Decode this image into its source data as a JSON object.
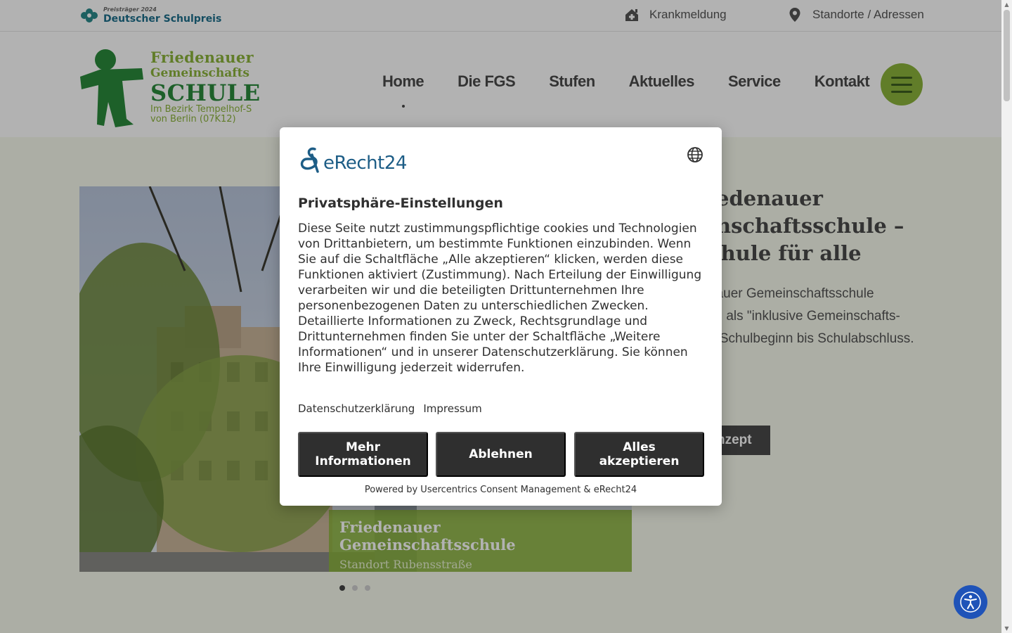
{
  "topbar": {
    "prize_small": "Preisträger 2024",
    "prize_big": "Deutscher Schulpreis",
    "krankmeldung": "Krankmeldung",
    "standorte": "Standorte / Adressen"
  },
  "logo": {
    "line1": "Friedenauer",
    "line2": "Gemeinschafts",
    "line3": "SCHULE",
    "line4a": "Im Bezirk Tempelhof-S",
    "line4b": "von Berlin (07K12)"
  },
  "nav": {
    "items": [
      "Home",
      "Die FGS",
      "Stufen",
      "Aktuelles",
      "Service",
      "Kontakt"
    ],
    "active": "Home"
  },
  "slider": {
    "caption_title": "Friedenauer Gemeinschaftsschule",
    "caption_sub": "Standort Rubensstraße",
    "dots": 3,
    "active_dot": 1
  },
  "hero": {
    "title": "iedenauer\ninschaftsschule –\nchule für alle",
    "body": "nauer Gemeinschaftsschule\nch als \"inklusive Gemeinschafts-\nn Schulbeginn bis Schulabschluss.",
    "button": "nzept"
  },
  "consent": {
    "brand": "eRecht24",
    "title": "Privatsphäre-Einstellungen",
    "description": "Diese Seite nutzt zustimmungspflichtige cookies und Technologien von Drittanbietern, um bestimmte Funktionen einzubinden. Wenn Sie auf die Schaltfläche „Alle akzeptieren“ klicken, werden diese Funktionen aktiviert (Zustimmung). Nach Erteilung der Einwilligung verarbeiten wir und die beteiligten Drittunternehmen Ihre personenbezogenen Daten zu unterschiedlichen Zwecken. Detaillierte Informationen zu Zweck, Rechtsgrundlage und Drittunternehmen finden Sie unter der Schaltfläche „Weitere Informationen“ und in unserer Datenschutzerklärung. Sie können Ihre Einwilligung jederzeit widerrufen.",
    "link_privacy": "Datenschutzerklärung",
    "link_imprint": "Impressum",
    "btn_more": "Mehr Informationen",
    "btn_deny": "Ablehnen",
    "btn_accept": "Alles akzeptieren",
    "powered": "Powered by Usercentrics Consent Management & eRecht24"
  },
  "icons": {
    "krankmeldung": "home-medical-icon",
    "standorte": "map-pin-icon",
    "language": "globe-icon",
    "menu": "hamburger-icon",
    "accessibility": "accessibility-icon"
  },
  "colors": {
    "brand_green": "#8cb43c",
    "dark_green": "#2a8a3c",
    "button_dark": "#2f2f2f",
    "accessibility_blue": "#1f53b8",
    "erecht_blue": "#1d5d86"
  }
}
